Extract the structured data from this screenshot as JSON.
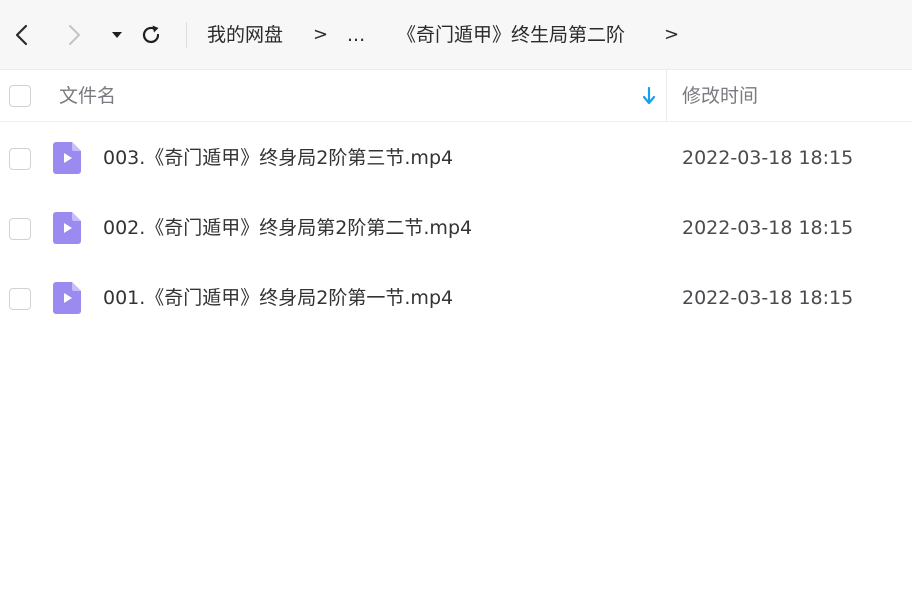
{
  "toolbar": {
    "breadcrumb": {
      "root": "我的网盘",
      "separator": ">",
      "ellipsis": "...",
      "current": "《奇门遁甲》终生局第二阶"
    }
  },
  "header": {
    "name_label": "文件名",
    "time_label": "修改时间",
    "sort_icon": "sort-descending-icon"
  },
  "files": [
    {
      "name": "003.《奇门遁甲》终身局2阶第三节.mp4",
      "modified": "2022-03-18 18:15",
      "icon": "video-file-icon"
    },
    {
      "name": "002.《奇门遁甲》终身局第2阶第二节.mp4",
      "modified": "2022-03-18 18:15",
      "icon": "video-file-icon"
    },
    {
      "name": "001.《奇门遁甲》终身局2阶第一节.mp4",
      "modified": "2022-03-18 18:15",
      "icon": "video-file-icon"
    }
  ],
  "colors": {
    "accent": "#1aa0ea",
    "video_icon": "#9b8bf0"
  }
}
